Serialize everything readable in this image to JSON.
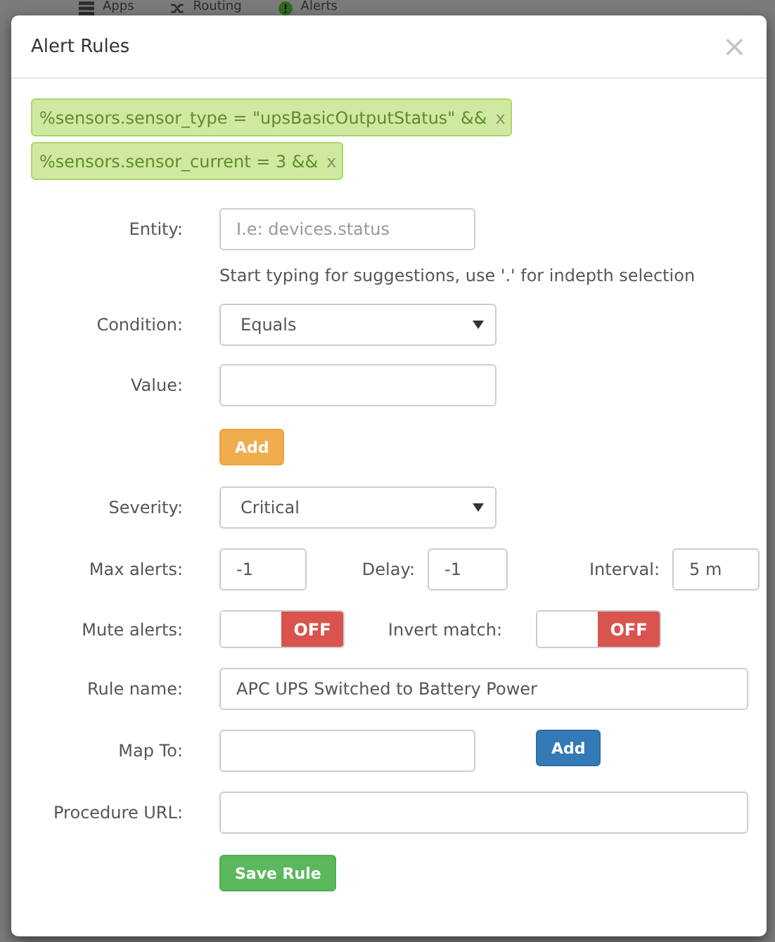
{
  "nav": [
    {
      "label": "Apps",
      "kind": "server"
    },
    {
      "label": "Routing",
      "kind": "routing"
    },
    {
      "label": "Alerts",
      "kind": "alert"
    }
  ],
  "dialog": {
    "title": "Alert Rules",
    "close": "×"
  },
  "tags": [
    {
      "text": "%sensors.sensor_type = \"upsBasicOutputStatus\" &&",
      "remove": "x"
    },
    {
      "text": "%sensors.sensor_current = 3 &&",
      "remove": "x"
    }
  ],
  "entity": {
    "label": "Entity:",
    "placeholder": "I.e: devices.status",
    "hint": "Start typing for suggestions, use '.' for indepth selection"
  },
  "condition": {
    "label": "Condition:",
    "value": "Equals"
  },
  "value": {
    "label": "Value:"
  },
  "add_button": {
    "label": "Add"
  },
  "severity": {
    "label": "Severity:",
    "value": "Critical"
  },
  "limits": [
    {
      "label": "Max alerts:",
      "value": "-1"
    },
    {
      "label": "Delay:",
      "value": "-1"
    },
    {
      "label": "Interval:",
      "value": "5 m"
    }
  ],
  "toggles": [
    {
      "label": "Mute alerts:",
      "on": false,
      "state_text": "OFF"
    },
    {
      "label": "Invert match:",
      "on": false,
      "state_text": "OFF"
    }
  ],
  "rule_name": {
    "label": "Rule name:",
    "value": "APC UPS Switched to Battery Power"
  },
  "map_to": {
    "label": "Map To:",
    "button": "Add"
  },
  "procedure_url": {
    "label": "Procedure URL:"
  },
  "save_button": {
    "label": "Save Rule"
  }
}
